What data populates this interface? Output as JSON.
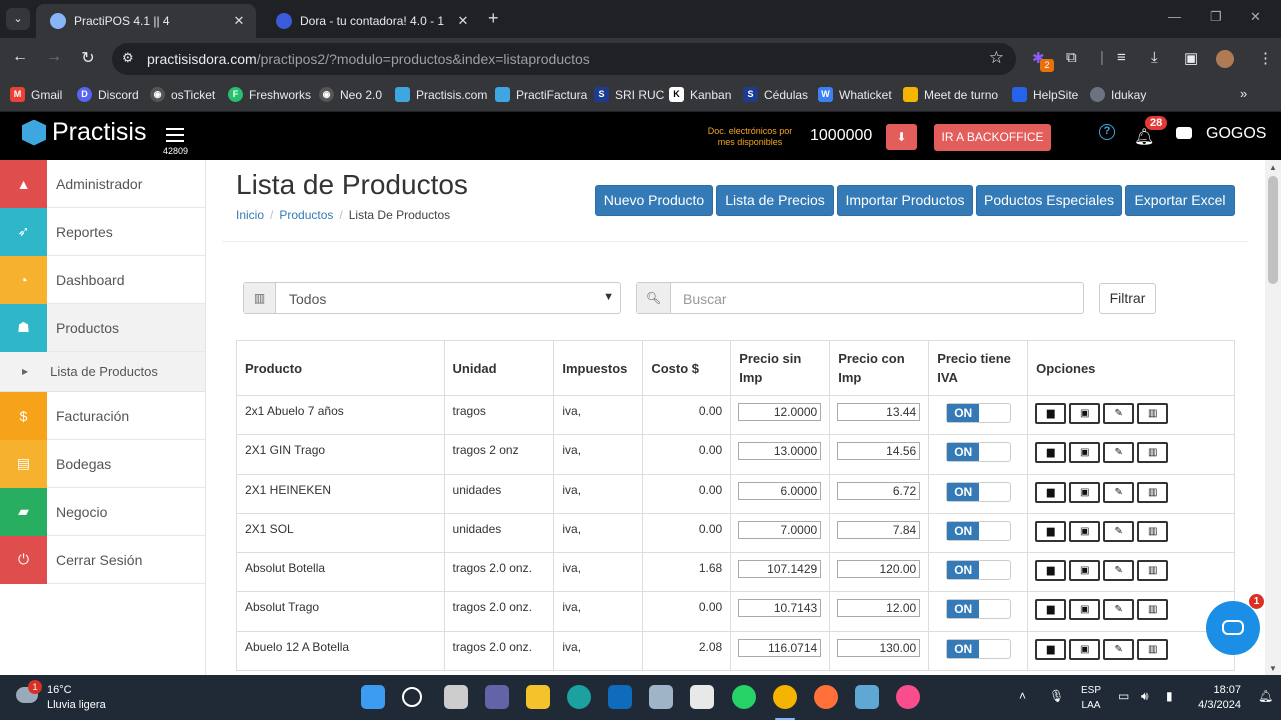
{
  "browser": {
    "tabs": [
      {
        "title": "PractiPOS 4.1 || 4"
      },
      {
        "title": "Dora - tu contadora! 4.0 - 1"
      }
    ],
    "url_host": "practisisdora.com",
    "url_path": "/practipos2/?modulo=productos&index=listaproductos",
    "extension_badge": "2",
    "bookmarks": [
      "Gmail",
      "Discord",
      "osTicket",
      "Freshworks",
      "Neo 2.0",
      "Practisis.com",
      "PractiFactura",
      "SRI RUC",
      "Kanban",
      "Cédulas",
      "Whaticket",
      "Meet de turno",
      "HelpSite",
      "Idukay"
    ]
  },
  "header": {
    "brand": "Practisis",
    "menu_number": "42809",
    "docs_label": "Doc. electrónicos por mes disponibles",
    "docs_value": "1000000",
    "backoffice_label": "IR A BACKOFFICE",
    "notifications_count": "28",
    "user": "GOGOS"
  },
  "sidebar": {
    "items": [
      {
        "label": "Administrador",
        "color": "#e04d4d"
      },
      {
        "label": "Reportes",
        "color": "#2fb7c9"
      },
      {
        "label": "Dashboard",
        "color": "#f6b12e"
      },
      {
        "label": "Productos",
        "color": "#2fb7c9"
      },
      {
        "label": "Facturación",
        "color": "#f7a21b"
      },
      {
        "label": "Bodegas",
        "color": "#f6b12e"
      },
      {
        "label": "Negocio",
        "color": "#27ae60"
      },
      {
        "label": "Cerrar Sesión",
        "color": "#e04d4d"
      }
    ],
    "sub_item": "Lista de Productos"
  },
  "page": {
    "title": "Lista de Productos",
    "breadcrumb": [
      "Inicio",
      "Productos",
      "Lista De Productos"
    ],
    "buttons": [
      "Nuevo Producto",
      "Lista de Precios",
      "Importar Productos",
      "Poductos Especiales",
      "Exportar Excel"
    ],
    "filter_select": "Todos",
    "search_placeholder": "Buscar",
    "filter_button": "Filtrar"
  },
  "table": {
    "columns": [
      "Producto",
      "Unidad",
      "Impuestos",
      "Costo $",
      "Precio sin Imp",
      "Precio con Imp",
      "Precio tiene IVA",
      "Opciones"
    ],
    "toggle_label": "ON",
    "rows": [
      {
        "producto": "2x1 Abuelo 7 años",
        "unidad": "tragos",
        "impuestos": "iva,",
        "costo": "0.00",
        "sin": "12.0000",
        "con": "13.44"
      },
      {
        "producto": "2X1 GIN Trago",
        "unidad": "tragos 2 onz",
        "impuestos": "iva,",
        "costo": "0.00",
        "sin": "13.0000",
        "con": "14.56"
      },
      {
        "producto": "2X1 HEINEKEN",
        "unidad": "unidades",
        "impuestos": "iva,",
        "costo": "0.00",
        "sin": "6.0000",
        "con": "6.72"
      },
      {
        "producto": "2X1 SOL",
        "unidad": "unidades",
        "impuestos": "iva,",
        "costo": "0.00",
        "sin": "7.0000",
        "con": "7.84"
      },
      {
        "producto": "Absolut Botella",
        "unidad": "tragos 2.0 onz.",
        "impuestos": "iva,",
        "costo": "1.68",
        "sin": "107.1429",
        "con": "120.00"
      },
      {
        "producto": "Absolut Trago",
        "unidad": "tragos 2.0 onz.",
        "impuestos": "iva,",
        "costo": "0.00",
        "sin": "10.7143",
        "con": "12.00"
      },
      {
        "producto": "Abuelo 12 A Botella",
        "unidad": "tragos 2.0 onz.",
        "impuestos": "iva,",
        "costo": "2.08",
        "sin": "116.0714",
        "con": "130.00"
      }
    ]
  },
  "chat_badge": "1",
  "taskbar": {
    "weather_temp": "16°C",
    "weather_desc": "Lluvia ligera",
    "weather_badge": "1",
    "lang1": "ESP",
    "lang2": "LAA",
    "time": "18:07",
    "date": "4/3/2024"
  }
}
